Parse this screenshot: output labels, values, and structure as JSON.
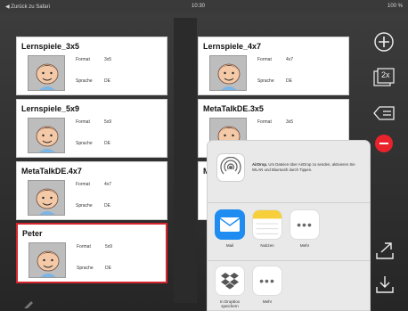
{
  "status_bar": {
    "back_label": "◀ Zurück zu Safari",
    "time": "10:30",
    "battery": "100 %"
  },
  "cards": [
    {
      "title": "Lernspiele_3x5",
      "format_label": "Format",
      "format_value": "3x5",
      "language_label": "Sprache",
      "language_value": "DE",
      "selected": false
    },
    {
      "title": "Lernspiele_4x7",
      "format_label": "Format",
      "format_value": "4x7",
      "language_label": "Sprache",
      "language_value": "DE",
      "selected": false
    },
    {
      "title": "Lernspiele_5x9",
      "format_label": "Format",
      "format_value": "5x9",
      "language_label": "Sprache",
      "language_value": "DE",
      "selected": false
    },
    {
      "title": "MetaTalkDE.3x5",
      "format_label": "Format",
      "format_value": "3x5",
      "language_label": "",
      "language_value": "",
      "selected": false
    },
    {
      "title": "MetaTalkDE.4x7",
      "format_label": "Format",
      "format_value": "4x7",
      "language_label": "Sprache",
      "language_value": "DE",
      "selected": false
    },
    {
      "title": "M",
      "format_label": "",
      "format_value": "",
      "language_label": "",
      "language_value": "",
      "selected": false
    },
    {
      "title": "Peter",
      "format_label": "Format",
      "format_value": "5x9",
      "language_label": "Sprache",
      "language_value": "DE",
      "selected": true
    }
  ],
  "share_sheet": {
    "airdrop_title": "AirDrop.",
    "airdrop_text": "Um Dateien über AirDrop zu senden, aktivieren Sie WLAN und Bluetooth durch Tippen.",
    "apps": [
      {
        "label": "Mail",
        "icon": "mail-icon"
      },
      {
        "label": "Notizen",
        "icon": "notes-icon"
      },
      {
        "label": "Mehr",
        "icon": "more-icon"
      }
    ],
    "actions": [
      {
        "label": "In Dropbox speichern",
        "icon": "dropbox-icon"
      },
      {
        "label": "Mehr",
        "icon": "more-icon"
      }
    ]
  },
  "toolbar": {
    "zoom_label": "2x"
  },
  "colors": {
    "selected_border": "#d6242c",
    "delete_button": "#e8232b",
    "mail_blue": "#1e8cf0",
    "notes_yellow": "#f7cf3a"
  }
}
